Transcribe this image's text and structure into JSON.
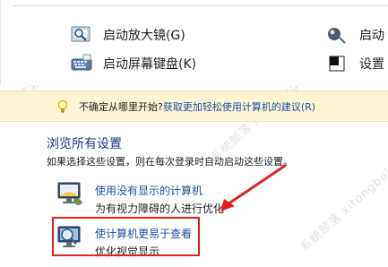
{
  "tools": {
    "magnifier": {
      "label": "启动放大镜(G)",
      "icon": "magnifier-icon"
    },
    "narrator": {
      "label": "启动",
      "icon": "narrator-icon"
    },
    "keyboard": {
      "label": "启动屏幕键盘(K)",
      "icon": "keyboard-icon"
    },
    "contrast": {
      "label": "设置",
      "icon": "contrast-icon"
    }
  },
  "tip": {
    "prefix": "不确定从哪里开始?",
    "link": "获取更加轻松使用计算机的建议(R)"
  },
  "browse": {
    "title": "浏览所有设置",
    "description": "如果选择这些设置，则在每次登录时自动启动这些设置。"
  },
  "settings": [
    {
      "title": "使用没有显示的计算机",
      "subtitle": "为有视力障碍的人进行优化",
      "icon": "monitor-icon"
    },
    {
      "title": "使计算机更易于查看",
      "subtitle": "优化视觉显示",
      "icon": "magnify-monitor-icon"
    }
  ],
  "watermark": {
    "text": "系统部落 xitongbuluo.com"
  },
  "colors": {
    "link": "#1e50a2",
    "title": "#1e3287",
    "tip_bg": "#fbf5d4",
    "highlight": "#e02020"
  }
}
